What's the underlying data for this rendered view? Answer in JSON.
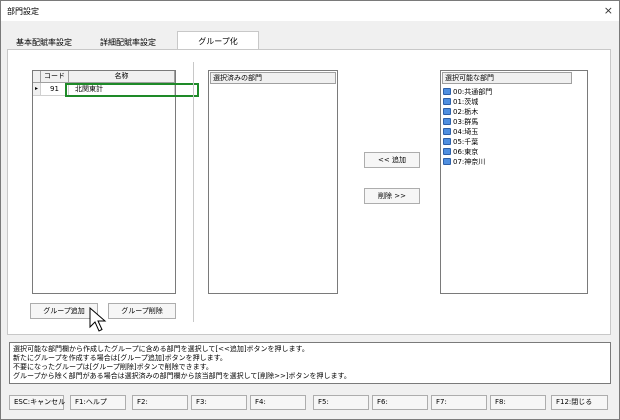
{
  "window": {
    "title": "部門設定",
    "close_glyph": "×"
  },
  "tabs": [
    {
      "label": "基本配賦率設定",
      "active": false
    },
    {
      "label": "詳細配賦率設定",
      "active": false
    },
    {
      "label": "グループ化",
      "active": true
    }
  ],
  "group_grid": {
    "headers": [
      "コード",
      "名称"
    ],
    "row_indicator": "▸",
    "rows": [
      {
        "code": "91",
        "name": "北関東計"
      }
    ]
  },
  "selected_depts": {
    "header": "選択済みの部門",
    "items": []
  },
  "available_depts": {
    "header": "選択可能な部門",
    "items": [
      "00:共通部門",
      "01:茨城",
      "02:栃木",
      "03:群馬",
      "04:埼玉",
      "05:千葉",
      "06:東京",
      "07:神奈川"
    ]
  },
  "buttons": {
    "add": "<< 追加",
    "remove": "削除 >>",
    "group_add": "グループ追加",
    "group_delete": "グループ削除"
  },
  "messages": [
    "選択可能な部門欄から作成したグループに含める部門を選択して[<<追加]ボタンを押します。",
    "新たにグループを作成する場合は[グループ追加]ボタンを押します。",
    "不要になったグループは[グループ削除]ボタンで削除できます。",
    "グループから除く部門がある場合は選択済みの部門欄から該当部門を選択して[削除>>]ボタンを押します。"
  ],
  "function_keys": [
    "ESC:キャンセル",
    "F1:ヘルプ",
    "F2:",
    "F3:",
    "F4:",
    "F5:",
    "F6:",
    "F7:",
    "F8:",
    "F12:閉じる"
  ]
}
